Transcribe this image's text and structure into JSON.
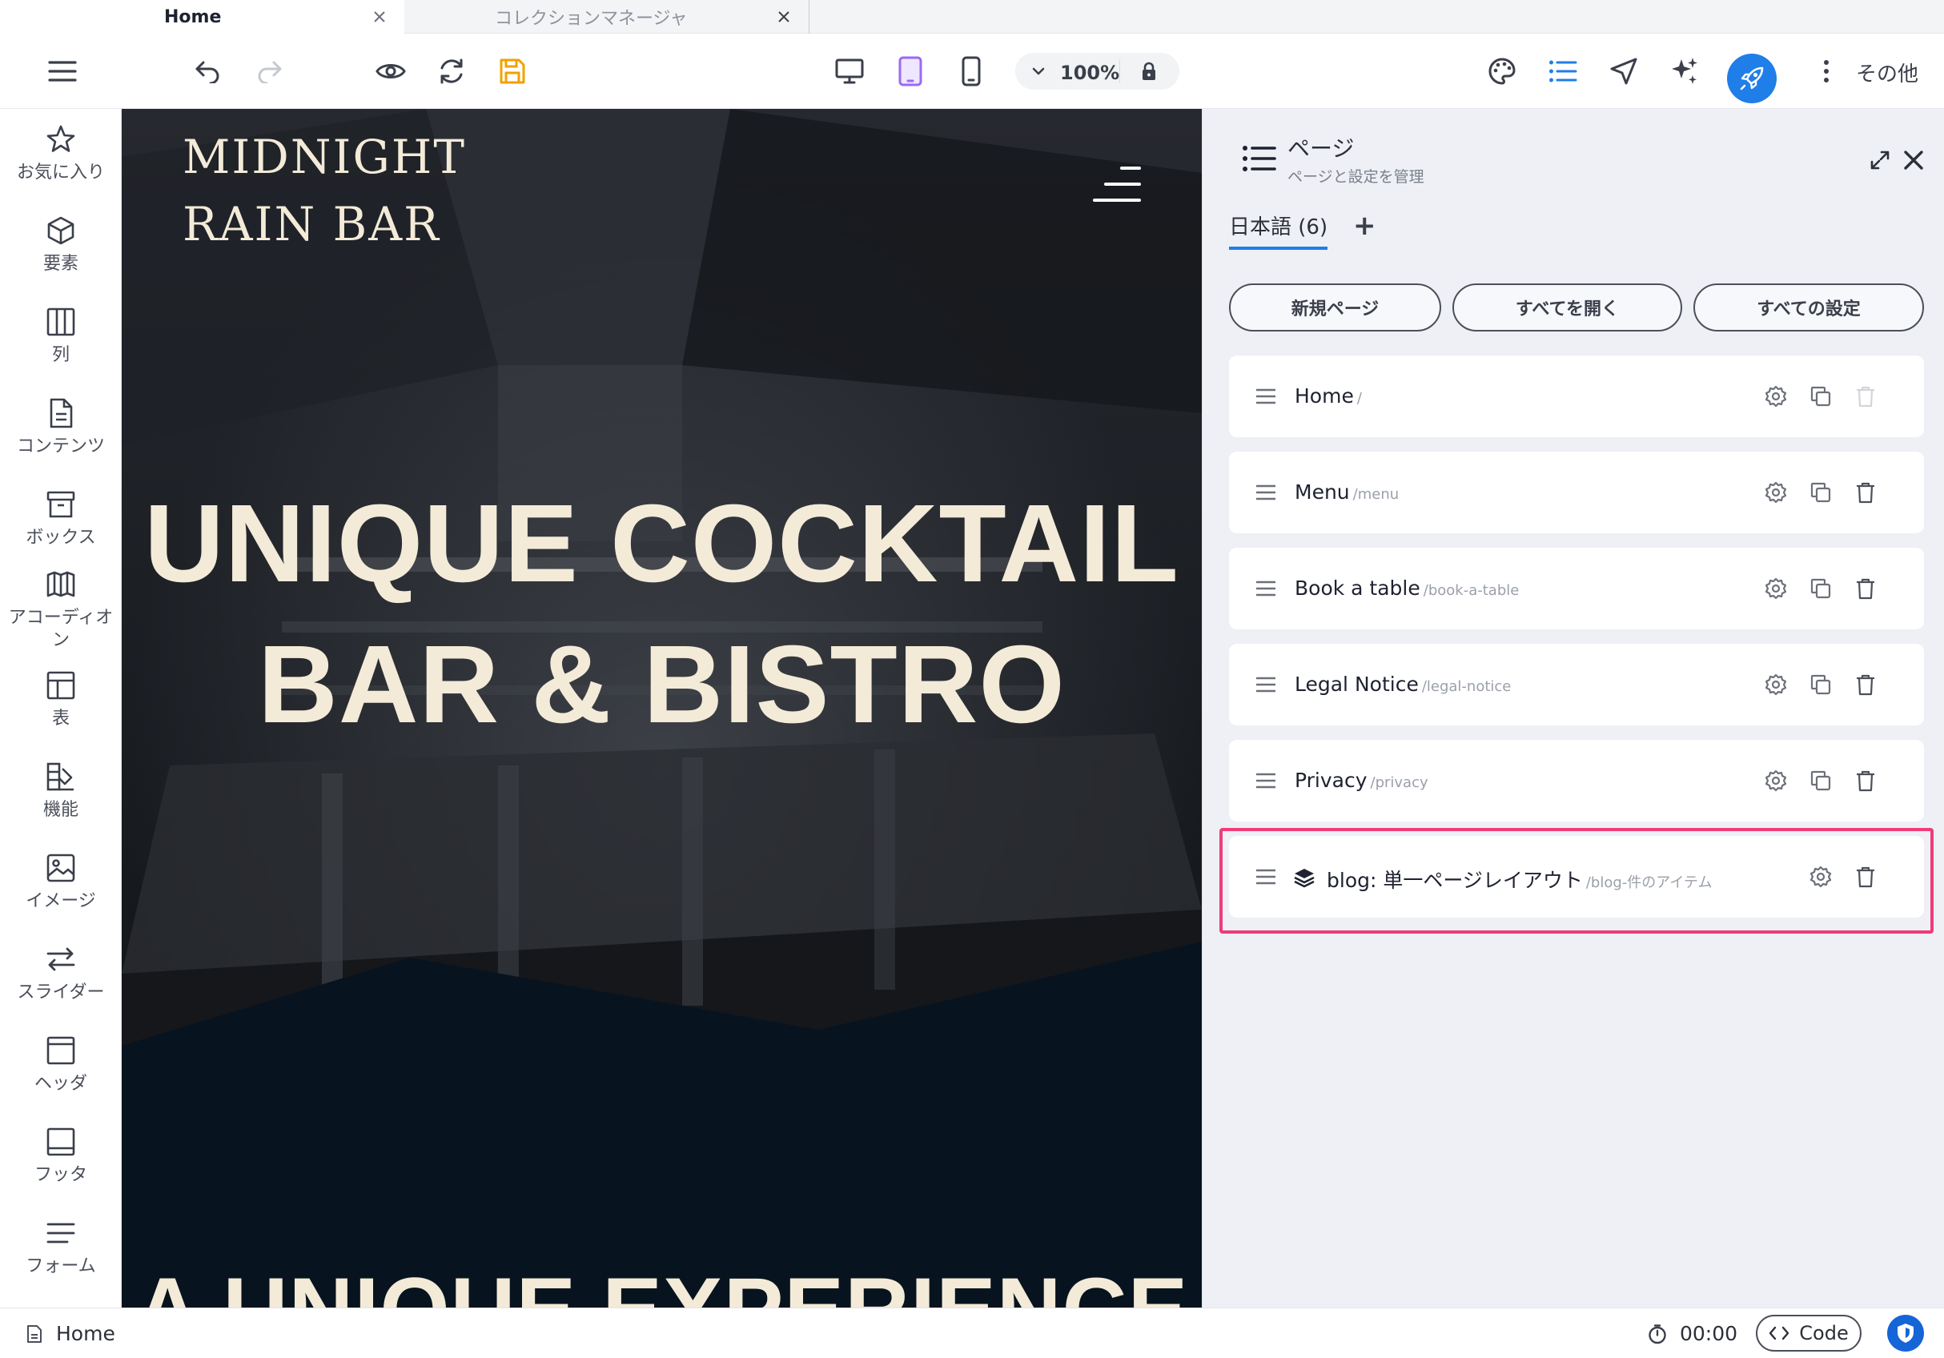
{
  "tabs": [
    {
      "label": "Home",
      "active": true
    },
    {
      "label": "コレクションマネージャ",
      "active": false
    }
  ],
  "toolbar": {
    "zoom": "100%",
    "more_label": "その他",
    "accent": "#1f7ee8",
    "save_color": "#f2a100",
    "tablet_active_color": "#9b6bf0"
  },
  "sidebar": {
    "items": [
      {
        "label": "お気に入り",
        "icon": "star-icon"
      },
      {
        "label": "要素",
        "icon": "cube-icon"
      },
      {
        "label": "列",
        "icon": "columns-icon"
      },
      {
        "label": "コンテンツ",
        "icon": "document-icon"
      },
      {
        "label": "ボックス",
        "icon": "box-icon"
      },
      {
        "label": "アコーディオン",
        "icon": "accordion-icon"
      },
      {
        "label": "表",
        "icon": "table-icon"
      },
      {
        "label": "機能",
        "icon": "features-icon"
      },
      {
        "label": "イメージ",
        "icon": "image-icon"
      },
      {
        "label": "スライダー",
        "icon": "slider-icon"
      },
      {
        "label": "ヘッダ",
        "icon": "header-icon"
      },
      {
        "label": "フッタ",
        "icon": "footer-icon"
      },
      {
        "label": "フォーム",
        "icon": "form-icon"
      }
    ]
  },
  "canvas": {
    "logo_line1": "MIDNIGHT",
    "logo_line2": "RAIN BAR",
    "hero_line1": "UNIQUE COCKTAIL",
    "hero_line2": "BAR & BISTRO",
    "section_title": "A UNIQUE EXPERIENCE"
  },
  "panel": {
    "title": "ページ",
    "subtitle": "ページと設定を管理",
    "language_tab": "日本語 (6)",
    "add_language": "+",
    "buttons": {
      "new_page": "新規ページ",
      "open_all": "すべてを開く",
      "all_settings": "すべての設定"
    },
    "pages": [
      {
        "name": "Home",
        "slug": "/"
      },
      {
        "name": "Menu",
        "slug": "/menu"
      },
      {
        "name": "Book a table",
        "slug": "/book-a-table"
      },
      {
        "name": "Legal Notice",
        "slug": "/legal-notice"
      },
      {
        "name": "Privacy",
        "slug": "/privacy"
      },
      {
        "name": "blog: 単一ページレイアウト",
        "slug": "/blog-件のアイテム",
        "highlighted": true
      }
    ],
    "highlight_color": "#ef3b78"
  },
  "statusbar": {
    "page": "Home",
    "timer": "00:00",
    "code_label": "Code"
  }
}
